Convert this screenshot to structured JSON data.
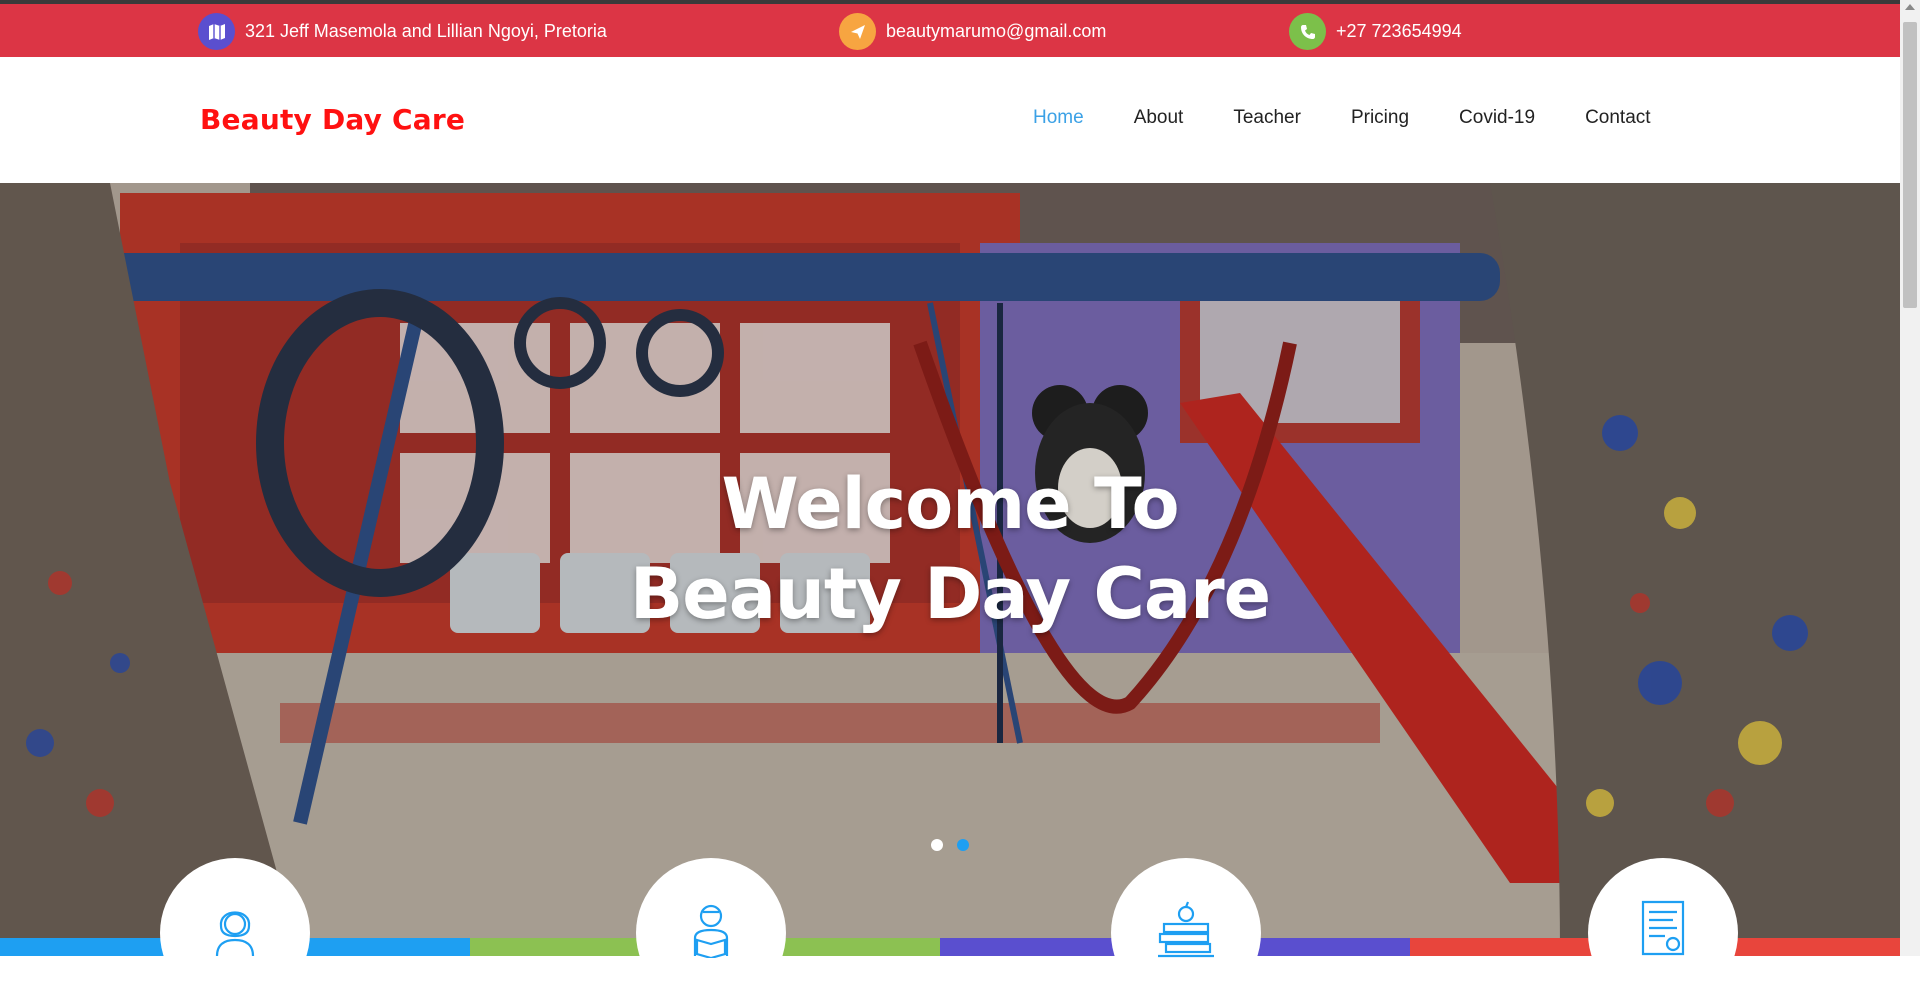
{
  "topbar": {
    "address": "321 Jeff Masemola and Lillian Ngoyi, Pretoria",
    "email": "beautymarumo@gmail.com",
    "phone": "+27 723654994",
    "icons": [
      "map-icon",
      "paper-plane-icon",
      "phone-icon"
    ],
    "icon_colors": [
      "#5a4fcf",
      "#f7a541",
      "#7cc04a"
    ],
    "background_color": "#dc3545"
  },
  "header": {
    "brand": "Beauty Day Care",
    "brand_color": "#ff1111",
    "nav": [
      {
        "label": "Home",
        "active": true
      },
      {
        "label": "About",
        "active": false
      },
      {
        "label": "Teacher",
        "active": false
      },
      {
        "label": "Pricing",
        "active": false
      },
      {
        "label": "Covid-19",
        "active": false
      },
      {
        "label": "Contact",
        "active": false
      }
    ],
    "active_color": "#3ba1e6"
  },
  "hero": {
    "title_line1": "Welcome To",
    "title_line2": "Beauty Day Care",
    "slides": 2,
    "active_slide": 2
  },
  "features": {
    "icons": [
      "teacher-icon",
      "reading-student-icon",
      "books-apple-icon",
      "certificate-icon"
    ],
    "strip_colors": [
      "#1e9ff2",
      "#8cc152",
      "#5a4fcf",
      "#e8453c"
    ]
  }
}
